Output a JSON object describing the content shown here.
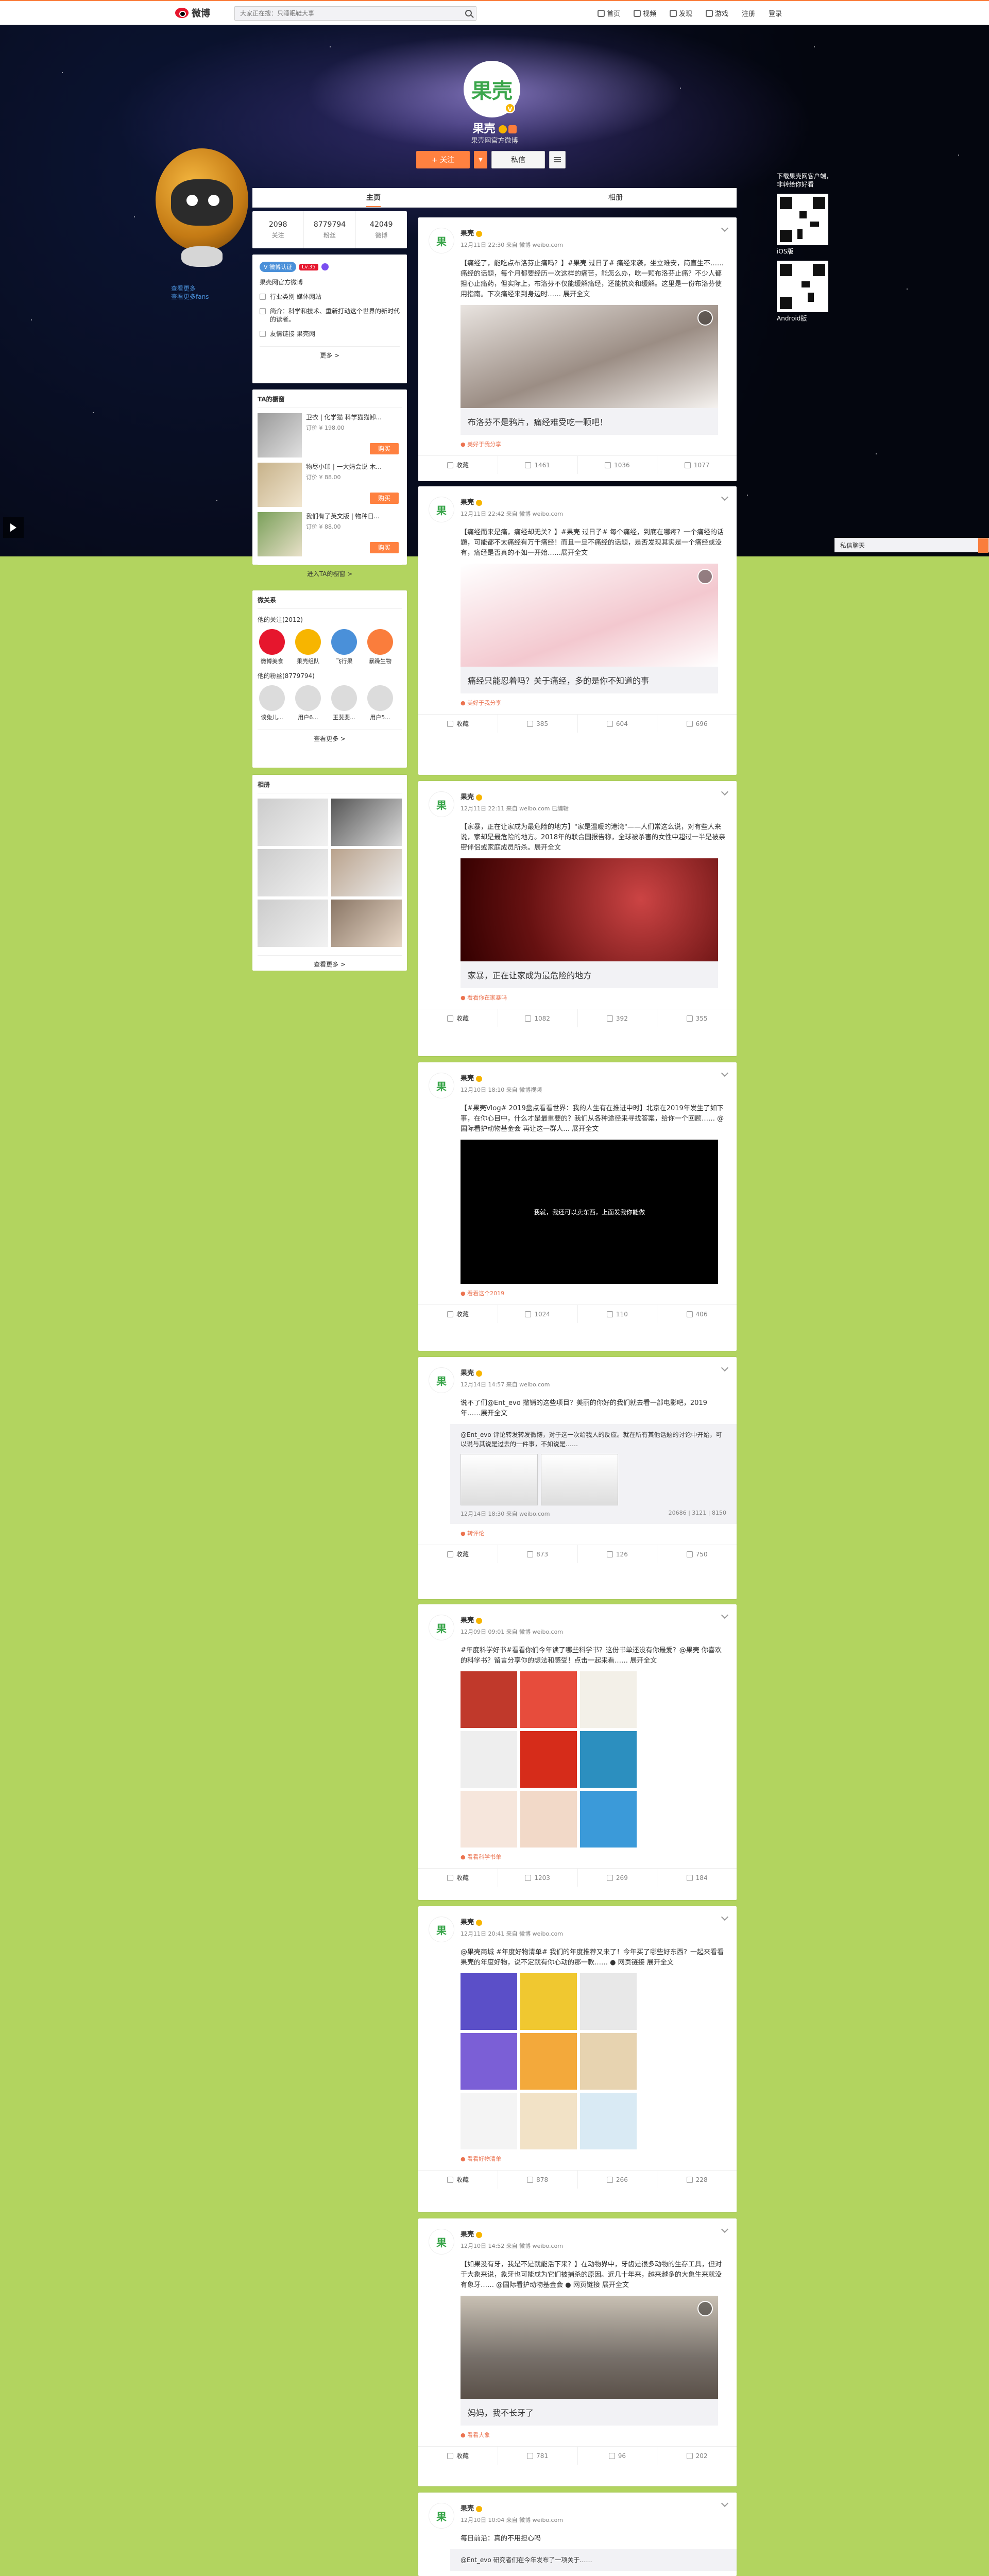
{
  "topnav": {
    "logo_text": "微博",
    "search_placeholder": "大家正在搜：只睡眠鞋大事",
    "links": [
      "首页",
      "视频",
      "发现",
      "游戏"
    ],
    "register": "注册",
    "login": "登录"
  },
  "profile": {
    "avatar_text": "果壳",
    "name": "果壳",
    "description": "果壳网官方微博",
    "follow_label": "+ 关注",
    "message_label": "私信",
    "tabs": [
      "主页",
      "相册"
    ]
  },
  "fan_links": [
    "查看更多",
    "查看更多fans"
  ],
  "qr": {
    "title": "下载果壳网客户端，非转给你好看",
    "ios_label": "iOS版",
    "android_label": "Android版"
  },
  "chatbar_label": "私信聊天",
  "stats": [
    {
      "num": "2098",
      "label": "关注"
    },
    {
      "num": "8779794",
      "label": "粉丝"
    },
    {
      "num": "42049",
      "label": "微博"
    }
  ],
  "info": {
    "vbadge": "V 微博认证",
    "level": "Lv.35",
    "verify": "果壳网官方微博",
    "lines": [
      {
        "text": "行业类别 媒体网站"
      },
      {
        "text": "简介：科学和技术、重新打动这个世界的新时代的读者。"
      },
      {
        "text": "友情链接 果壳网"
      }
    ],
    "more": "更多 >"
  },
  "shop": {
    "title": "TA的橱窗",
    "items": [
      {
        "title": "卫衣 | 化学猫 科学猫猫卸...",
        "price": "订价 ¥ 198.00",
        "buy": "购买"
      },
      {
        "title": "物尽小印 | 一大妈会说 木...",
        "price": "订价 ¥ 88.00",
        "buy": "购买"
      },
      {
        "title": "我们有了英文版 | 物种日...",
        "price": "订价 ¥ 88.00",
        "buy": "购买"
      }
    ],
    "more": "进入TA的橱窗 >"
  },
  "relations": {
    "title": "微关系",
    "follow_title": "他的关注(2012)",
    "follows": [
      {
        "name": "微博美食",
        "color": "#e6162d"
      },
      {
        "name": "果壳组队",
        "color": "#f7b500"
      },
      {
        "name": "飞行果",
        "color": "#4a90d9"
      },
      {
        "name": "暴躁生物",
        "color": "#fa7d3c"
      }
    ],
    "fans_title": "他的粉丝(8779794)",
    "fans": [
      {
        "name": "谈兔儿...",
        "color": "#dcdcdc"
      },
      {
        "name": "用户6...",
        "color": "#dcdcdc"
      },
      {
        "name": "王斐斐...",
        "color": "#dcdcdc"
      },
      {
        "name": "用户5...",
        "color": "#dcdcdc"
      }
    ],
    "more": "查看更多 >"
  },
  "album": {
    "title": "相册",
    "more": "查看更多 >"
  },
  "posts": [
    {
      "name": "果壳",
      "meta": "12月11日 22:30 来自 微博 weibo.com",
      "text": "【痛经了，能吃点布洛芬止痛吗？】#果壳 过日子# 痛经来袭，坐立难安，简直生不……痛经的话题，每个月都要经历一次这样的痛苦，能怎么办，吃一颗布洛芬止痛？不少人都担心止痛药，但实际上，布洛芬不仅能缓解痛经，还能抗炎和缓解。这里是一份布洛芬使用指南。下次痛经来到身边时…… 展开全文",
      "card": "布洛芬不是鸦片，痛经难受吃一颗吧！",
      "source": "● 美好于我分享",
      "repost": "1461",
      "comment": "1036",
      "like": "1077"
    },
    {
      "name": "果壳",
      "meta": "12月11日 22:42 来自 微博 weibo.com",
      "text": "【痛经而来是痛，痛经却无关？】#果壳 过日子# 每个痛经，到底在哪疼？一个痛经的话题，可能都不太痛经有万千痛经！而且一旦不痛经的话题，是否发现其实是一个痛经或没有，痛经是否真的不如一开始……展开全文",
      "card": "痛经只能忍着吗？关于痛经，多的是你不知道的事",
      "source": "● 美好于我分享",
      "repost": "385",
      "comment": "604",
      "like": "696"
    },
    {
      "name": "果壳",
      "meta": "12月11日 22:11 来自 weibo.com 已编辑",
      "text": "【家暴，正在让家成为最危险的地方】\"家是温暖的港湾\"——人们常这么说，对有些人来说，家却是最危险的地方。2018年的联合国报告称，全球被杀害的女性中超过一半是被亲密伴侣或家庭成员所杀。展开全文",
      "card": "家暴，正在让家成为最危险的地方",
      "source": "● 看看你在家暴吗",
      "repost": "1082",
      "comment": "392",
      "like": "355"
    },
    {
      "name": "果壳",
      "meta": "12月10日 18:10 来自 微博视频",
      "text": "【#果壳Vlog# 2019盘点看看世界：我的人生有在推进中时】北京在2019年发生了如下事，在你心目中，什么才是最重要的？我们从各种途径来寻找答案，给你一个回顾…… @国际看护动物基金会 再让这一群人… 展开全文",
      "video_caption": "我就，我还可以卖东西，上面发我你能做",
      "source": "● 看看这个2019",
      "repost": "1024",
      "comment": "110",
      "like": "406"
    },
    {
      "name": "果壳",
      "meta": "12月14日 14:57 来自 weibo.com",
      "text": "说不了们@Ent_evo 撤销的这些项目？美丽的你好的我们就去看一部电影吧，2019年……展开全文",
      "repost_text": "@Ent_evo 评论转发转发微博，对于这一次给我人的反应。就在所有其他话题的讨论中开始，可以说与其说是过去的一件事，不如说是……",
      "repost_meta": "12月14日 18:30 来自 weibo.com",
      "repost_nums": "20686 | 3121 | 8150",
      "source": "● 转评论",
      "repost": "873",
      "comment": "126",
      "like": "750"
    },
    {
      "name": "果壳",
      "meta": "12月09日 09:01 来自 微博 weibo.com",
      "text": "#年度科学好书#看看你们今年读了哪些科学书？这份书单还没有你最爱？@果壳 你喜欢的科学书？留言分享你的想法和感受！点击一起来看…… 展开全文",
      "source": "● 看看科学书单",
      "repost": "1203",
      "comment": "269",
      "like": "184"
    },
    {
      "name": "果壳",
      "meta": "12月11日 20:41 来自 微博 weibo.com",
      "text": "@果壳商城 #年度好物清单# 我们的年度推荐又来了！今年买了哪些好东西？一起来看看果壳的年度好物，说不定就有你心动的那一款…… ● 网页链接 展开全文",
      "source": "● 看看好物清单",
      "repost": "878",
      "comment": "266",
      "like": "228"
    },
    {
      "name": "果壳",
      "meta": "12月10日 14:52 来自 微博 weibo.com",
      "text": "【如果没有牙，我是不是就能活下来？】在动物界中，牙齿是很多动物的生存工具，但对于大象来说，象牙也可能成为它们被捕杀的原因。近几十年来，越来越多的大象生来就没有象牙…… @国际看护动物基金会 ● 网页链接 展开全文",
      "card": "妈妈，我不长牙了",
      "source": "● 看看大象",
      "repost": "781",
      "comment": "96",
      "like": "202"
    },
    {
      "name": "果壳",
      "meta": "12月10日 10:04 来自 微博 weibo.com",
      "text": "每日前沿：真的不用担心吗",
      "repost_text": "@Ent_evo 研究者们在今年发布了一项关于……",
      "source": "",
      "repost": "",
      "comment": "",
      "like": ""
    }
  ]
}
